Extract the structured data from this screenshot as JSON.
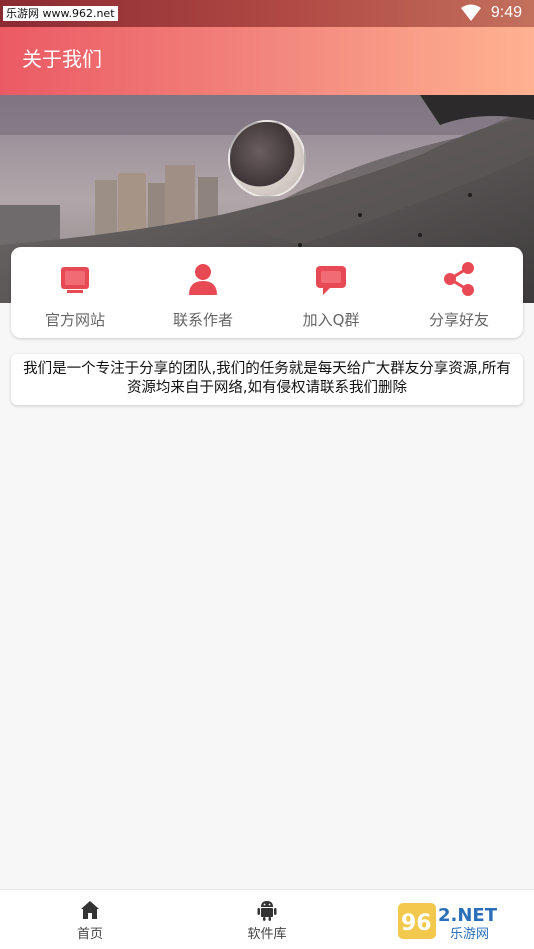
{
  "status_bar": {
    "watermark": "乐游网 www.962.net",
    "time": "9:49"
  },
  "header": {
    "title": "关于我们"
  },
  "actions": [
    {
      "label": "官方网站",
      "icon": "website-icon"
    },
    {
      "label": "联系作者",
      "icon": "contact-author-icon"
    },
    {
      "label": "加入Q群",
      "icon": "join-group-icon"
    },
    {
      "label": "分享好友",
      "icon": "share-icon"
    }
  ],
  "about_text": "我们是一个专注于分享的团队,我们的任务就是每天给广大群友分享资源,所有资源均来自于网络,如有侵权请联系我们删除",
  "bottom_nav": [
    {
      "label": "首页",
      "icon": "home-icon"
    },
    {
      "label": "软件库",
      "icon": "android-icon"
    }
  ],
  "corner_logo": "962.NET 乐游网",
  "colors": {
    "accent": "#e84a55",
    "header_start": "#eb5a64",
    "header_end": "#ffb190"
  }
}
